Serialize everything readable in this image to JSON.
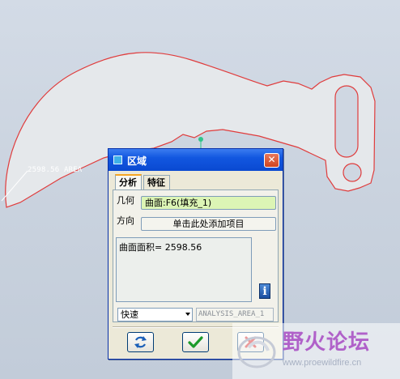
{
  "viewport": {
    "area_label": "2598.56 AREA",
    "background_color": "#cfd7e2",
    "curve_color": "#e03c3c",
    "fill_color": "#e4e7ea"
  },
  "dialog": {
    "title": "区域",
    "close_glyph": "✕",
    "tabs": [
      {
        "label": "分析",
        "active": true
      },
      {
        "label": "特征",
        "active": false
      }
    ],
    "geometry_label": "几何",
    "geometry_value": "曲面:F6(填充_1)",
    "direction_label": "方向",
    "direction_value": "单击此处添加项目",
    "result_text": "曲面面积= 2598.56",
    "info_glyph": "i",
    "mode_select": "快速",
    "analysis_name": "ANALYSIS_AREA_1",
    "buttons": [
      {
        "name": "repeat",
        "icon": "repeat-icon"
      },
      {
        "name": "ok",
        "icon": "checkmark-icon"
      },
      {
        "name": "cancel",
        "icon": "cross-icon"
      }
    ]
  },
  "watermark": {
    "brand": "野火论坛",
    "url": "www.proewildfire.cn"
  }
}
